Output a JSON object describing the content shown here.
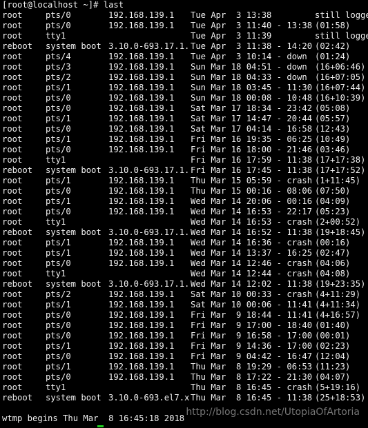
{
  "prompt": "[root@localhost ~]# last",
  "sessions": [
    {
      "user": "root",
      "tty": "pts/0",
      "host": "192.168.139.1",
      "when": "Tue Apr  3 13:38",
      "duration": "still logged in"
    },
    {
      "user": "root",
      "tty": "pts/0",
      "host": "192.168.139.1",
      "when": "Tue Apr  3 11:40 - 13:38",
      "duration": "(01:58)"
    },
    {
      "user": "root",
      "tty": "tty1",
      "host": "",
      "when": "Tue Apr  3 11:39",
      "duration": "still logged in"
    },
    {
      "user": "reboot",
      "tty": "system boot",
      "host": "3.10.0-693.17.1.",
      "when": "Tue Apr  3 11:38 - 14:20",
      "duration": "(02:42)"
    },
    {
      "user": "root",
      "tty": "pts/4",
      "host": "192.168.139.1",
      "when": "Tue Apr  3 10:14 - down",
      "duration": "(01:24)"
    },
    {
      "user": "root",
      "tty": "pts/3",
      "host": "192.168.139.1",
      "when": "Sun Mar 18 04:51 - down",
      "duration": "(16+06:46)"
    },
    {
      "user": "root",
      "tty": "pts/2",
      "host": "192.168.139.1",
      "when": "Sun Mar 18 04:33 - down",
      "duration": "(16+07:05)"
    },
    {
      "user": "root",
      "tty": "pts/1",
      "host": "192.168.139.1",
      "when": "Sun Mar 18 03:45 - 11:30",
      "duration": "(16+07:44)"
    },
    {
      "user": "root",
      "tty": "pts/0",
      "host": "192.168.139.1",
      "when": "Sun Mar 18 00:08 - 10:48",
      "duration": "(16+10:39)"
    },
    {
      "user": "root",
      "tty": "pts/0",
      "host": "192.168.139.1",
      "when": "Sat Mar 17 18:34 - 23:42",
      "duration": "(05:08)"
    },
    {
      "user": "root",
      "tty": "pts/1",
      "host": "192.168.139.1",
      "when": "Sat Mar 17 14:47 - 20:44",
      "duration": "(05:57)"
    },
    {
      "user": "root",
      "tty": "pts/0",
      "host": "192.168.139.1",
      "when": "Sat Mar 17 04:14 - 16:58",
      "duration": "(12:43)"
    },
    {
      "user": "root",
      "tty": "pts/1",
      "host": "192.168.139.1",
      "when": "Fri Mar 16 19:35 - 06:25",
      "duration": "(10:49)"
    },
    {
      "user": "root",
      "tty": "pts/0",
      "host": "192.168.139.1",
      "when": "Fri Mar 16 18:00 - 21:46",
      "duration": "(03:46)"
    },
    {
      "user": "root",
      "tty": "tty1",
      "host": "",
      "when": "Fri Mar 16 17:59 - 11:38",
      "duration": "(17+17:38)"
    },
    {
      "user": "reboot",
      "tty": "system boot",
      "host": "3.10.0-693.17.1.",
      "when": "Fri Mar 16 17:45 - 11:38",
      "duration": "(17+17:52)"
    },
    {
      "user": "root",
      "tty": "pts/1",
      "host": "192.168.139.1",
      "when": "Thu Mar 15 05:59 - crash",
      "duration": "(1+11:45)"
    },
    {
      "user": "root",
      "tty": "pts/0",
      "host": "192.168.139.1",
      "when": "Thu Mar 15 00:16 - 08:06",
      "duration": "(07:50)"
    },
    {
      "user": "root",
      "tty": "pts/1",
      "host": "192.168.139.1",
      "when": "Wed Mar 14 20:06 - 00:16",
      "duration": "(04:09)"
    },
    {
      "user": "root",
      "tty": "pts/0",
      "host": "192.168.139.1",
      "when": "Wed Mar 14 16:53 - 22:17",
      "duration": "(05:23)"
    },
    {
      "user": "root",
      "tty": "tty1",
      "host": "",
      "when": "Wed Mar 14 16:53 - crash",
      "duration": "(2+00:52)"
    },
    {
      "user": "reboot",
      "tty": "system boot",
      "host": "3.10.0-693.17.1.",
      "when": "Wed Mar 14 16:52 - 11:38",
      "duration": "(19+18:45)"
    },
    {
      "user": "root",
      "tty": "pts/1",
      "host": "192.168.139.1",
      "when": "Wed Mar 14 16:36 - crash",
      "duration": "(00:16)"
    },
    {
      "user": "root",
      "tty": "pts/1",
      "host": "192.168.139.1",
      "when": "Wed Mar 14 13:37 - 16:25",
      "duration": "(02:47)"
    },
    {
      "user": "root",
      "tty": "pts/0",
      "host": "192.168.139.1",
      "when": "Wed Mar 14 12:46 - crash",
      "duration": "(04:06)"
    },
    {
      "user": "root",
      "tty": "tty1",
      "host": "",
      "when": "Wed Mar 14 12:44 - crash",
      "duration": "(04:08)"
    },
    {
      "user": "reboot",
      "tty": "system boot",
      "host": "3.10.0-693.17.1.",
      "when": "Wed Mar 14 12:02 - 11:38",
      "duration": "(19+23:35)"
    },
    {
      "user": "root",
      "tty": "pts/2",
      "host": "192.168.139.1",
      "when": "Sat Mar 10 00:33 - crash",
      "duration": "(4+11:29)"
    },
    {
      "user": "root",
      "tty": "pts/1",
      "host": "192.168.139.1",
      "when": "Sat Mar 10 00:06 - 11:41",
      "duration": "(4+11:34)"
    },
    {
      "user": "root",
      "tty": "pts/0",
      "host": "192.168.139.1",
      "when": "Fri Mar  9 18:44 - 11:41",
      "duration": "(4+16:57)"
    },
    {
      "user": "root",
      "tty": "pts/0",
      "host": "192.168.139.1",
      "when": "Fri Mar  9 17:00 - 18:40",
      "duration": "(01:40)"
    },
    {
      "user": "root",
      "tty": "pts/0",
      "host": "192.168.139.1",
      "when": "Fri Mar  9 16:58 - 17:00",
      "duration": "(00:01)"
    },
    {
      "user": "root",
      "tty": "pts/1",
      "host": "192.168.139.1",
      "when": "Fri Mar  9 14:36 - 17:00",
      "duration": "(02:23)"
    },
    {
      "user": "root",
      "tty": "pts/0",
      "host": "192.168.139.1",
      "when": "Fri Mar  9 04:42 - 16:47",
      "duration": "(12:04)"
    },
    {
      "user": "root",
      "tty": "pts/1",
      "host": "192.168.139.1",
      "when": "Thu Mar  8 19:29 - 06:53",
      "duration": "(11:23)"
    },
    {
      "user": "root",
      "tty": "pts/0",
      "host": "192.168.139.1",
      "when": "Thu Mar  8 17:22 - 21:30",
      "duration": "(04:07)"
    },
    {
      "user": "root",
      "tty": "tty1",
      "host": "",
      "when": "Thu Mar  8 16:45 - crash",
      "duration": "(5+19:16)"
    },
    {
      "user": "reboot",
      "tty": "system boot",
      "host": "3.10.0-693.el7.x",
      "when": "Thu Mar  8 16:45 - 11:38",
      "duration": "(25+18:53)"
    }
  ],
  "footer": "wtmp begins Thu Mar  8 16:45:18 2018",
  "watermark": "http://blog.csdn.net/UtopiaOfArtoria",
  "colors": {
    "background": "#000000",
    "text": "#f0f0f0",
    "cursor": "#20d020"
  }
}
